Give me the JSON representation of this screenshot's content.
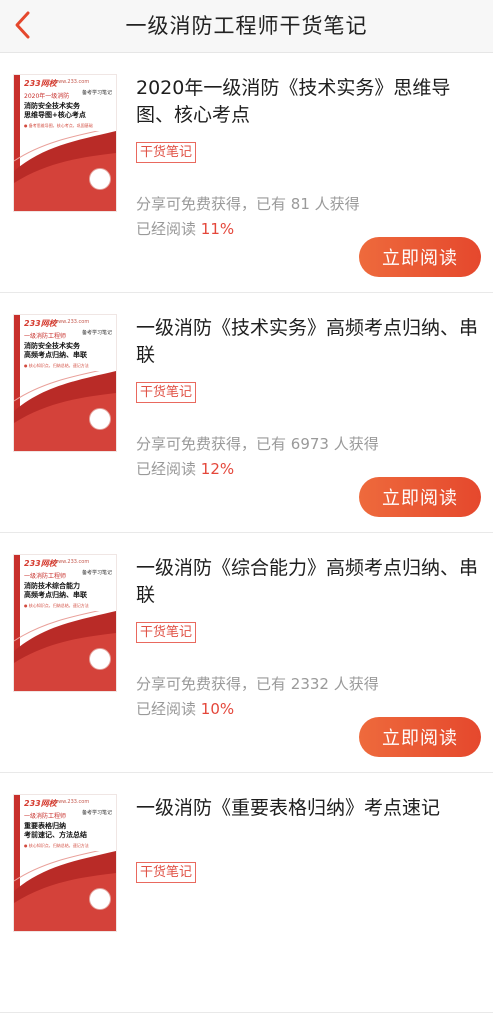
{
  "header": {
    "title": "一级消防工程师干货笔记",
    "back_icon": "chevron-left-icon"
  },
  "colors": {
    "accent": "#e5482d",
    "tag": "#e05246",
    "cover_red": "#c8302c"
  },
  "items": [
    {
      "title": "2020年一级消防《技术实务》思维导图、核心考点",
      "tag": "干货笔记",
      "shared_text": "分享可免费获得，已有 81 人获得",
      "read_label": "已经阅读 ",
      "read_percent": "11%",
      "button": "立即阅读",
      "cover": {
        "logo": "233网校",
        "url": "www.233.com",
        "series": "备考学习笔记",
        "year": "2020年一级消防",
        "title": "消防安全技术实务\n思维导图+核心考点",
        "sub": "● 备考思维导图，核心考点，巩固基础"
      }
    },
    {
      "title": "一级消防《技术实务》高频考点归纳、串联",
      "tag": "干货笔记",
      "shared_text": "分享可免费获得，已有 6973 人获得",
      "read_label": "已经阅读 ",
      "read_percent": "12%",
      "button": "立即阅读",
      "cover": {
        "logo": "233网校",
        "url": "www.233.com",
        "series": "备考学习笔记",
        "year": "一级消防工程师",
        "title": "消防安全技术实务\n高频考点归纳、串联",
        "sub": "● 核心知识点，归纳总结，速记方法"
      }
    },
    {
      "title": "一级消防《综合能力》高频考点归纳、串联",
      "tag": "干货笔记",
      "shared_text": "分享可免费获得，已有 2332 人获得",
      "read_label": "已经阅读 ",
      "read_percent": "10%",
      "button": "立即阅读",
      "cover": {
        "logo": "233网校",
        "url": "www.233.com",
        "series": "备考学习笔记",
        "year": "一级消防工程师",
        "title": "消防技术综合能力\n高频考点归纳、串联",
        "sub": "● 核心知识点，归纳总结，速记方法"
      }
    },
    {
      "title": "一级消防《重要表格归纳》考点速记",
      "tag": "干货笔记",
      "shared_text": "",
      "read_label": "",
      "read_percent": "",
      "button": "",
      "cover": {
        "logo": "233网校",
        "url": "www.233.com",
        "series": "备考学习笔记",
        "year": "一级消防工程师",
        "title": "重要表格归纳\n考前速记、方法总结",
        "sub": "● 核心知识点，归纳总结，速记方法"
      }
    }
  ]
}
